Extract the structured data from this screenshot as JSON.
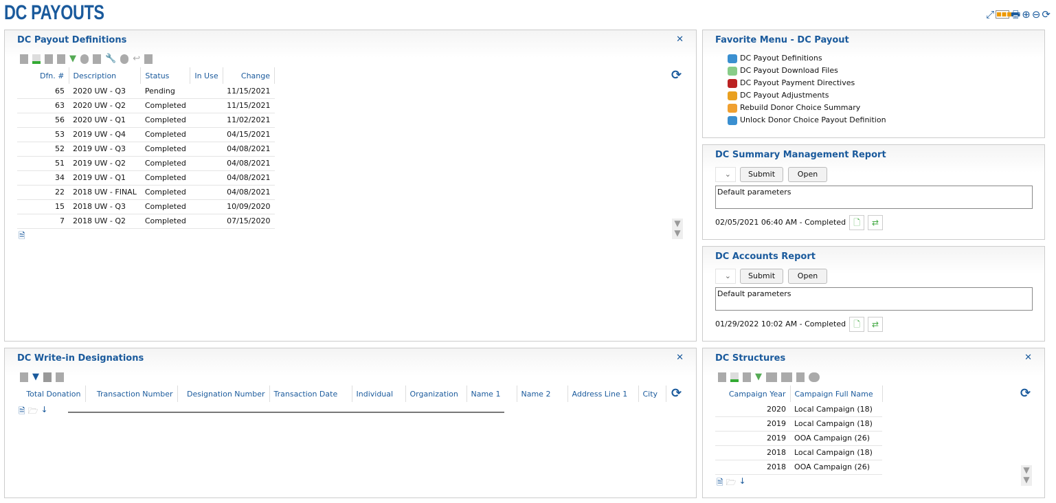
{
  "page": {
    "title": "DC PAYOUTS"
  },
  "top_icons": [
    "expand-icon",
    "layout-icon",
    "print-icon",
    "add-circle-icon",
    "remove-circle-icon",
    "refresh-icon"
  ],
  "payout_definitions": {
    "title": "DC Payout Definitions",
    "columns": [
      "Dfn. #",
      "Description",
      "Status",
      "In Use",
      "Change"
    ],
    "rows": [
      [
        "65",
        "2020 UW - Q3",
        "Pending",
        "",
        "11/15/2021"
      ],
      [
        "63",
        "2020 UW - Q2",
        "Completed",
        "",
        "11/15/2021"
      ],
      [
        "56",
        "2020 UW - Q1",
        "Completed",
        "",
        "11/02/2021"
      ],
      [
        "53",
        "2019 UW - Q4",
        "Completed",
        "",
        "04/15/2021"
      ],
      [
        "52",
        "2019 UW - Q3",
        "Completed",
        "",
        "04/08/2021"
      ],
      [
        "51",
        "2019 UW - Q2",
        "Completed",
        "",
        "04/08/2021"
      ],
      [
        "34",
        "2019 UW - Q1",
        "Completed",
        "",
        "04/08/2021"
      ],
      [
        "22",
        "2018 UW - FINAL",
        "Completed",
        "",
        "04/08/2021"
      ],
      [
        "15",
        "2018 UW - Q3",
        "Completed",
        "",
        "10/09/2020"
      ],
      [
        "7",
        "2018 UW - Q2",
        "Completed",
        "",
        "07/15/2020"
      ]
    ]
  },
  "favorites": {
    "title": "Favorite Menu - DC Payout",
    "items": [
      {
        "label": "DC Payout Definitions",
        "color": "#3a8fd0"
      },
      {
        "label": "DC Payout Download Files",
        "color": "#8c8"
      },
      {
        "label": "DC Payout Payment Directives",
        "color": "#b22"
      },
      {
        "label": "DC Payout Adjustments",
        "color": "#e9a020"
      },
      {
        "label": "Rebuild Donor Choice Summary",
        "color": "#f0a030"
      },
      {
        "label": "Unlock Donor Choice Payout Definition",
        "color": "#3a8fd0"
      }
    ]
  },
  "summary_report": {
    "title": "DC Summary Management Report",
    "submit": "Submit",
    "open": "Open",
    "params": "Default parameters",
    "status": "02/05/2021 06:40 AM - Completed"
  },
  "accounts_report": {
    "title": "DC Accounts Report",
    "submit": "Submit",
    "open": "Open",
    "params": "Default parameters",
    "status": "01/29/2022 10:02 AM - Completed"
  },
  "writein": {
    "title": "DC Write-in Designations",
    "columns": [
      "Total Donation",
      "Transaction Number",
      "Designation Number",
      "Transaction Date",
      "Individual",
      "Organization",
      "Name 1",
      "Name 2",
      "Address Line 1",
      "City"
    ]
  },
  "structures": {
    "title": "DC Structures",
    "columns": [
      "Campaign Year",
      "Campaign Full Name"
    ],
    "rows": [
      [
        "2020",
        "Local Campaign  (18)"
      ],
      [
        "2019",
        "Local Campaign  (18)"
      ],
      [
        "2019",
        "OOA Campaign  (26)"
      ],
      [
        "2018",
        "Local Campaign  (18)"
      ],
      [
        "2018",
        "OOA Campaign  (26)"
      ]
    ]
  }
}
